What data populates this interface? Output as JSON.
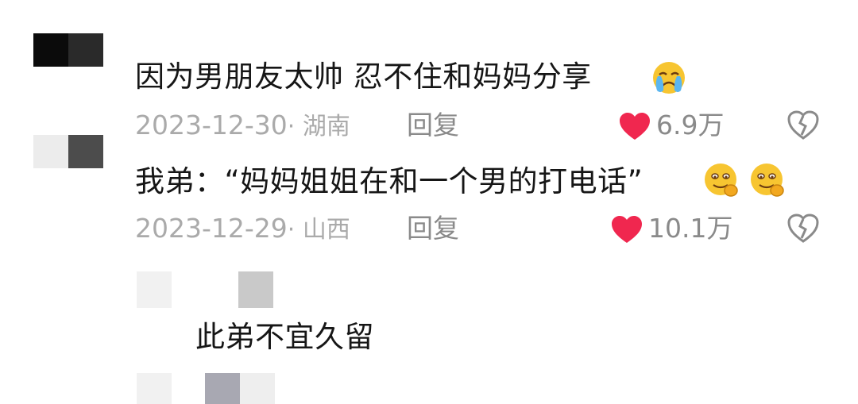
{
  "comments": [
    {
      "text": "因为男朋友太帅  忍不住和妈妈分享",
      "emoji": "crying-face-emoji",
      "date": "2023-12-30",
      "location": "· 湖南",
      "reply_label": "回复",
      "likes": "6.9万"
    },
    {
      "text": "我弟：“妈妈姐姐在和一个男的打电话”",
      "emoji": "drooling-yum-face-emoji",
      "date": "2023-12-29",
      "location": "· 山西",
      "reply_label": "回复",
      "likes": "10.1万"
    },
    {
      "text": "此弟不宜久留"
    }
  ],
  "colors": {
    "heart": "#f0274f",
    "meta_gray": "#aaaaaa",
    "reply_gray": "#8a8a8a"
  }
}
